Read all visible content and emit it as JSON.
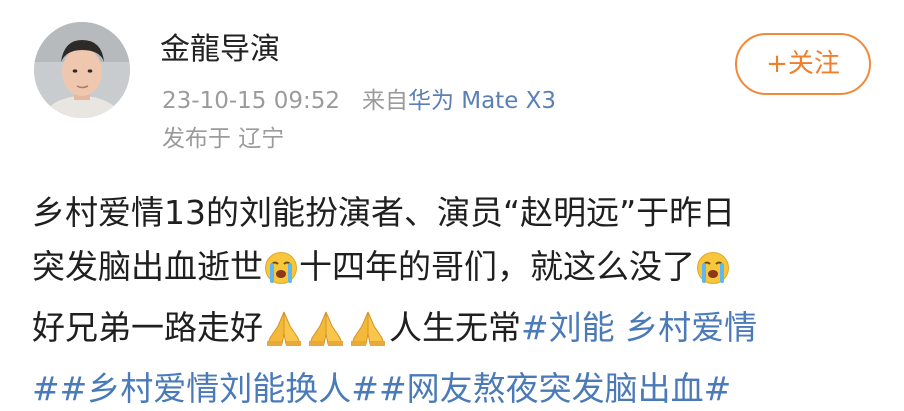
{
  "user": {
    "name": "金龍导演",
    "avatar": "avatar-photo"
  },
  "meta": {
    "timestamp": "23-10-15 09:52",
    "source_prefix": "来自",
    "source": "华为 Mate X3",
    "location": "发布于 辽宁"
  },
  "follow_button": {
    "label": "+关注"
  },
  "post": {
    "line1": "乡村爱情13的刘能扮演者、演员“赵明远”于昨日",
    "line2_a": "突发脑出血逝世",
    "line2_b": "十四年的哥们，就这么没了",
    "line3_a": "好兄弟一路走好",
    "line3_b": "人生无常",
    "hashtag1": "#刘能 乡村爱情",
    "hashtag2": "##乡村爱情刘能换人#",
    "hashtag3": "#网友熬夜突发脑出血#"
  },
  "icons": {
    "crying": "crying-face-icon",
    "pray": "folded-hands-icon"
  },
  "colors": {
    "accent_orange": "#f07e2a",
    "link_blue": "#4a7ab8",
    "source_blue": "#5b7fb5",
    "meta_gray": "#9b9b9b"
  }
}
